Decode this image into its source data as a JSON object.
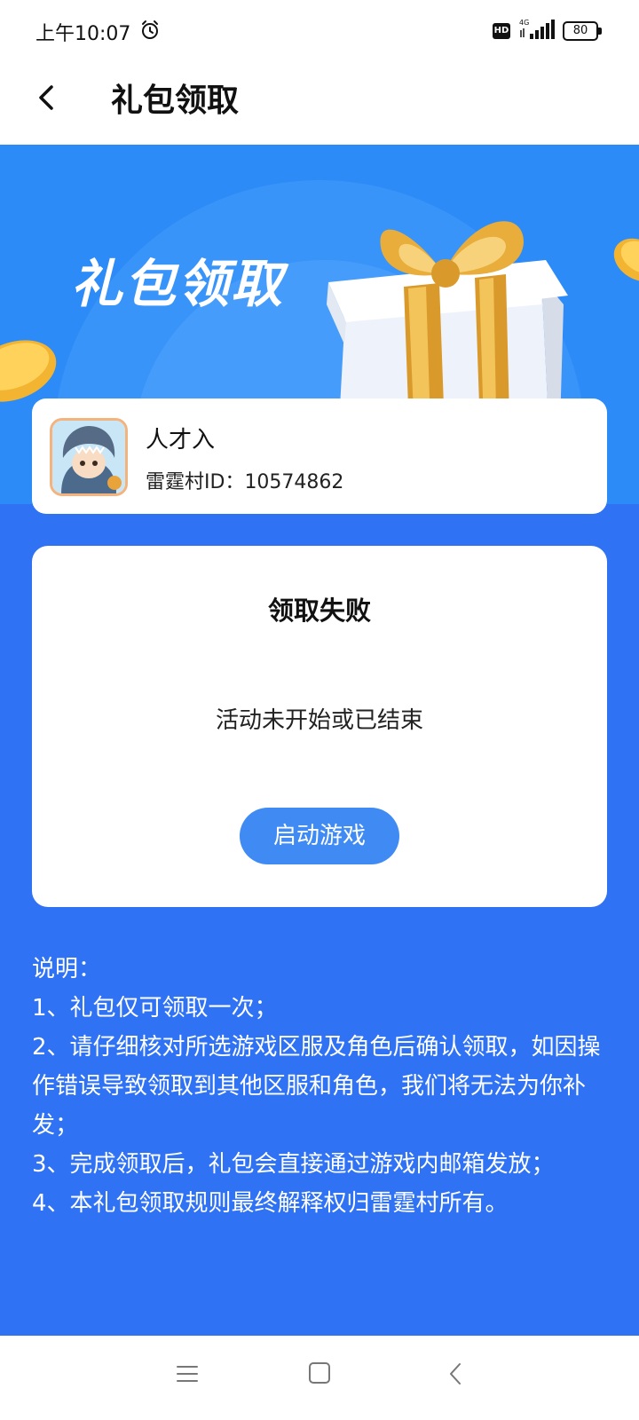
{
  "status_bar": {
    "time": "上午10:07",
    "network": "4G",
    "hd_label": "HD",
    "battery": "80"
  },
  "nav": {
    "title": "礼包领取"
  },
  "banner": {
    "title": "礼包领取"
  },
  "user": {
    "name": "人才入",
    "id_label": "雷霆村ID：",
    "id_value": "10574862"
  },
  "result": {
    "title": "领取失败",
    "message": "活动未开始或已结束",
    "button_label": "启动游戏"
  },
  "notes": {
    "heading": "说明：",
    "items": [
      "1、礼包仅可领取一次；",
      "2、请仔细核对所选游戏区服及角色后确认领取，如因操作错误导致领取到其他区服和角色，我们将无法为你补发；",
      "3、完成领取后，礼包会直接通过游戏内邮箱发放；",
      "4、本礼包领取规则最终解释权归雷霆村所有。"
    ]
  },
  "colors": {
    "banner_blue": "#2d8bf7",
    "content_blue": "#2f72f4",
    "button_blue": "#3f8bf3"
  },
  "icons": {
    "alarm": "alarm-icon",
    "signal": "signal-icon",
    "battery": "battery-icon",
    "back": "back-icon",
    "sys_menu": "menu-icon",
    "sys_home": "home-icon",
    "sys_back": "back-icon"
  }
}
